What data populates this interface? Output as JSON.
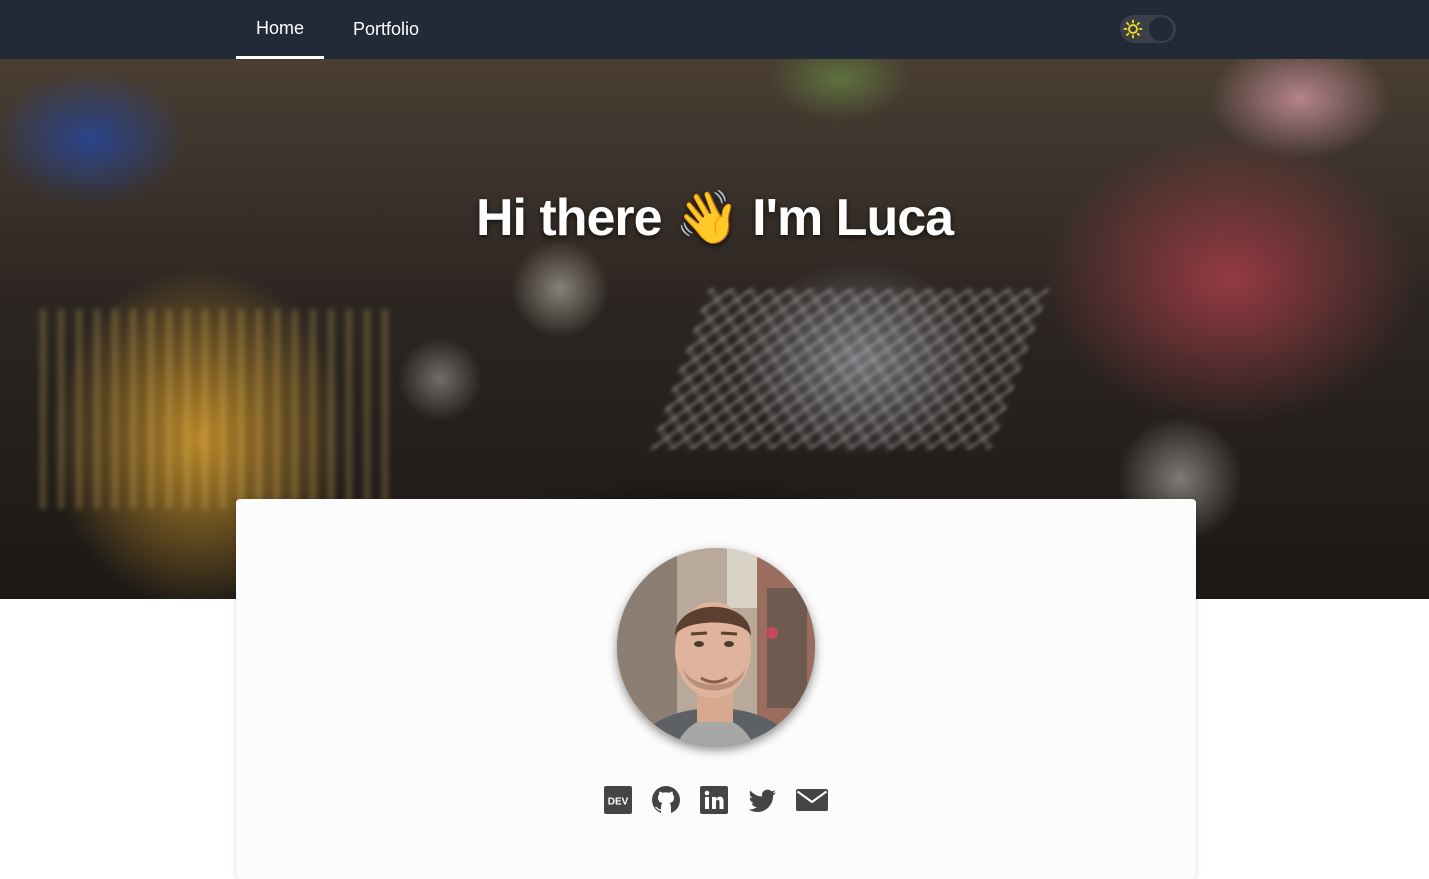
{
  "nav": {
    "items": [
      {
        "label": "Home",
        "active": true
      },
      {
        "label": "Portfolio",
        "active": false
      }
    ],
    "theme_toggle": {
      "icon": "sun-icon",
      "state": "light"
    }
  },
  "hero": {
    "title": "Hi there 👋 I'm Luca"
  },
  "profile": {
    "avatar": "profile-photo"
  },
  "social": [
    {
      "icon": "dev-icon"
    },
    {
      "icon": "github-icon"
    },
    {
      "icon": "linkedin-icon"
    },
    {
      "icon": "twitter-icon"
    },
    {
      "icon": "email-icon"
    }
  ],
  "colors": {
    "navbar": "#222a38",
    "icon": "#444444",
    "card": "#fcfcfc"
  }
}
